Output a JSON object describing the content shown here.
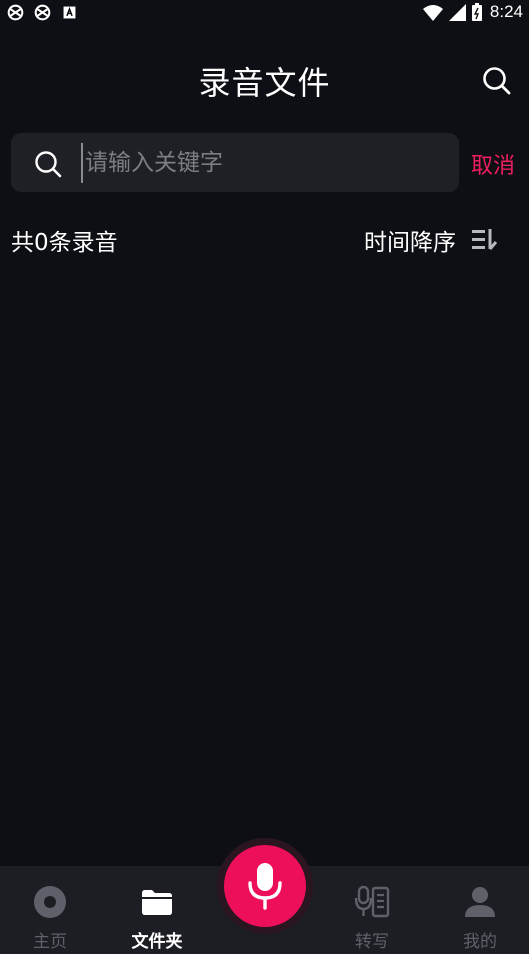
{
  "status_bar": {
    "time": "8:24",
    "left_icons": [
      "sync-icon",
      "sync-icon",
      "accessibility-icon"
    ],
    "right_icons": [
      "wifi-icon",
      "signal-icon",
      "battery-icon"
    ]
  },
  "header": {
    "title": "录音文件",
    "search_icon": "search-icon"
  },
  "search": {
    "placeholder": "请输入关键字",
    "value": "",
    "cancel_label": "取消"
  },
  "list": {
    "count_text": "共0条录音",
    "sort_label": "时间降序",
    "sort_icon": "sort-icon"
  },
  "bottom_nav": {
    "items": [
      {
        "label": "主页",
        "icon": "home-icon",
        "active": false
      },
      {
        "label": "文件夹",
        "icon": "folder-icon",
        "active": true
      },
      {
        "label": "转写",
        "icon": "transcribe-icon",
        "active": false
      },
      {
        "label": "我的",
        "icon": "profile-icon",
        "active": false
      }
    ],
    "record_icon": "microphone-icon"
  },
  "colors": {
    "background": "#0e0f14",
    "accent": "#ee0f5b",
    "cancel": "#ee1e5f",
    "inactive": "#5e606a",
    "search_bg": "#1f2026",
    "nav_bg": "#1d1e24"
  }
}
